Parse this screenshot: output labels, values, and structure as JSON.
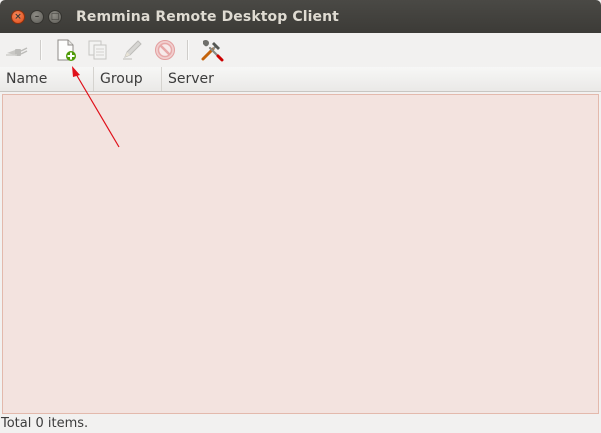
{
  "window": {
    "title": "Remmina Remote Desktop Client",
    "close_glyph": "×",
    "minimize_glyph": "–",
    "maximize_glyph": "□"
  },
  "toolbar": {
    "items": [
      {
        "name": "connect",
        "icon": "plug-connect-icon",
        "enabled": false
      },
      {
        "name": "new",
        "icon": "new-document-add-icon",
        "enabled": true
      },
      {
        "name": "copy",
        "icon": "copy-icon",
        "enabled": false
      },
      {
        "name": "edit",
        "icon": "pencil-edit-icon",
        "enabled": false
      },
      {
        "name": "delete",
        "icon": "no-entry-delete-icon",
        "enabled": false
      },
      {
        "name": "preferences",
        "icon": "tools-preferences-icon",
        "enabled": true
      }
    ]
  },
  "list": {
    "columns": [
      "Name",
      "Group",
      "Server"
    ],
    "rows": []
  },
  "status": {
    "text": "Total 0 items."
  },
  "colors": {
    "titlebar": "#3c3b37",
    "list_background": "#f3e3df",
    "annotation_arrow": "#e0101a"
  }
}
